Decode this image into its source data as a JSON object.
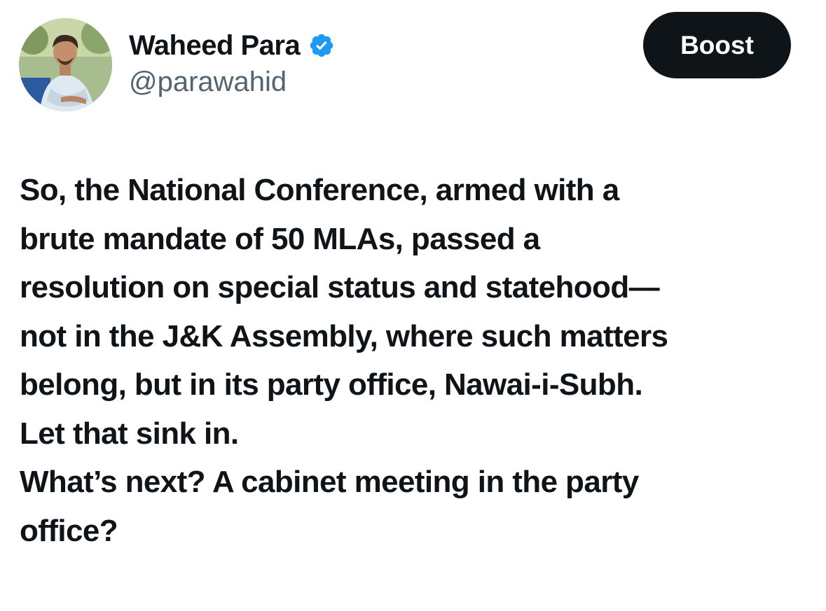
{
  "author": {
    "display_name": "Waheed Para",
    "handle": "@parawahid",
    "verified": true,
    "avatar_icon": "profile-photo",
    "verified_badge_icon": "verified-badge-icon",
    "verified_color": "#1d9bf0"
  },
  "actions": {
    "boost_label": "Boost"
  },
  "tweet": {
    "lines": [
      "So, the National Conference, armed with a",
      "brute mandate of 50 MLAs, passed a",
      "resolution on special status and statehood—",
      "not in the J&K Assembly, where such matters",
      "belong, but in its party office, Nawai-i-Subh.",
      "Let that sink in.",
      "What’s next? A cabinet meeting in the party",
      "office?"
    ]
  },
  "colors": {
    "text": "#0f1419",
    "secondary_text": "#536471",
    "button_bg": "#0f1419",
    "button_text": "#ffffff"
  }
}
